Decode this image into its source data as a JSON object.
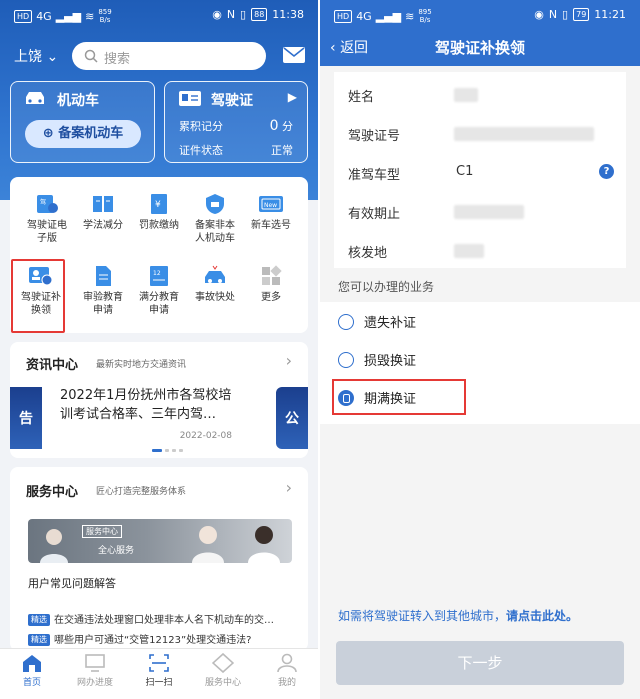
{
  "left": {
    "status": {
      "signal": "4G",
      "speed_top": "859",
      "speed_bottom": "B/s",
      "battery": "88",
      "time": "11:38"
    },
    "header": {
      "city": "上饶",
      "search_placeholder": "搜索"
    },
    "vehicle_card": {
      "title": "机动车",
      "button": "备案机动车"
    },
    "license_card": {
      "title": "驾驶证",
      "points_label": "累积记分",
      "points_value": "0",
      "points_unit": "分",
      "status_label": "证件状态",
      "status_value": "正常"
    },
    "services": [
      {
        "line1": "驾驶证电",
        "line2": "子版",
        "icon": "license-id-icon"
      },
      {
        "line1": "学法减分",
        "line2": "",
        "icon": "book-icon"
      },
      {
        "line1": "罚款缴纳",
        "line2": "",
        "icon": "bill-icon"
      },
      {
        "line1": "备案非本",
        "line2": "人机动车",
        "icon": "shield-car-icon"
      },
      {
        "line1": "新车选号",
        "line2": "",
        "icon": "new-plate-icon"
      },
      {
        "line1": "驾驶证补",
        "line2": "换领",
        "icon": "license-swap-icon"
      },
      {
        "line1": "审验教育",
        "line2": "申请",
        "icon": "document-icon"
      },
      {
        "line1": "满分教育",
        "line2": "申请",
        "icon": "score-doc-icon"
      },
      {
        "line1": "事故快处",
        "line2": "",
        "icon": "accident-car-icon"
      },
      {
        "line1": "更多",
        "line2": "",
        "icon": "grid-more-icon"
      }
    ],
    "news": {
      "title": "资讯中心",
      "subtitle": "最新实时地方交通资讯",
      "headline_1": "2022年1月份抚州市各驾校培",
      "headline_2": "训考试合格率、三年内驾…",
      "date": "2022-02-08",
      "left_badge": "告",
      "right_badge": "公"
    },
    "service_center": {
      "title": "服务中心",
      "subtitle": "匠心打造完整服务体系",
      "banner_tag": "服务中心",
      "banner_text": "全心服务",
      "faq_title": "用户常见问题解答",
      "faq": [
        {
          "tag": "精选",
          "text": "在交通违法处理窗口处理非本人名下机动车的交…"
        },
        {
          "tag": "精选",
          "text": "哪些用户可通过“交管12123”处理交通违法?"
        }
      ]
    },
    "tabs": [
      {
        "label": "首页",
        "icon": "home-icon"
      },
      {
        "label": "网办进度",
        "icon": "monitor-icon"
      },
      {
        "label": "扫一扫",
        "icon": "scan-icon"
      },
      {
        "label": "服务中心",
        "icon": "diamond-icon"
      },
      {
        "label": "我的",
        "icon": "user-icon"
      }
    ]
  },
  "right": {
    "status": {
      "signal": "4G",
      "speed_top": "895",
      "speed_bottom": "B/s",
      "battery": "79",
      "time": "11:21"
    },
    "nav": {
      "back": "返回",
      "title": "驾驶证补换领"
    },
    "info_rows": [
      {
        "label": "姓名",
        "value": ""
      },
      {
        "label": "驾驶证号",
        "value": ""
      },
      {
        "label": "准驾车型",
        "value": "C1"
      },
      {
        "label": "有效期止",
        "value": ""
      },
      {
        "label": "核发地",
        "value": ""
      }
    ],
    "business_title": "您可以办理的业务",
    "options": [
      {
        "label": "遗失补证",
        "checked": false
      },
      {
        "label": "损毁换证",
        "checked": false
      },
      {
        "label": "期满换证",
        "checked": true
      }
    ],
    "transfer_text": "如需将驾驶证转入到其他城市，",
    "transfer_link": "请点击此处。",
    "next_button": "下一步"
  },
  "colors": {
    "primary": "#2f6fcd",
    "highlight": "#e53935",
    "disabled": "#c9d0da"
  }
}
